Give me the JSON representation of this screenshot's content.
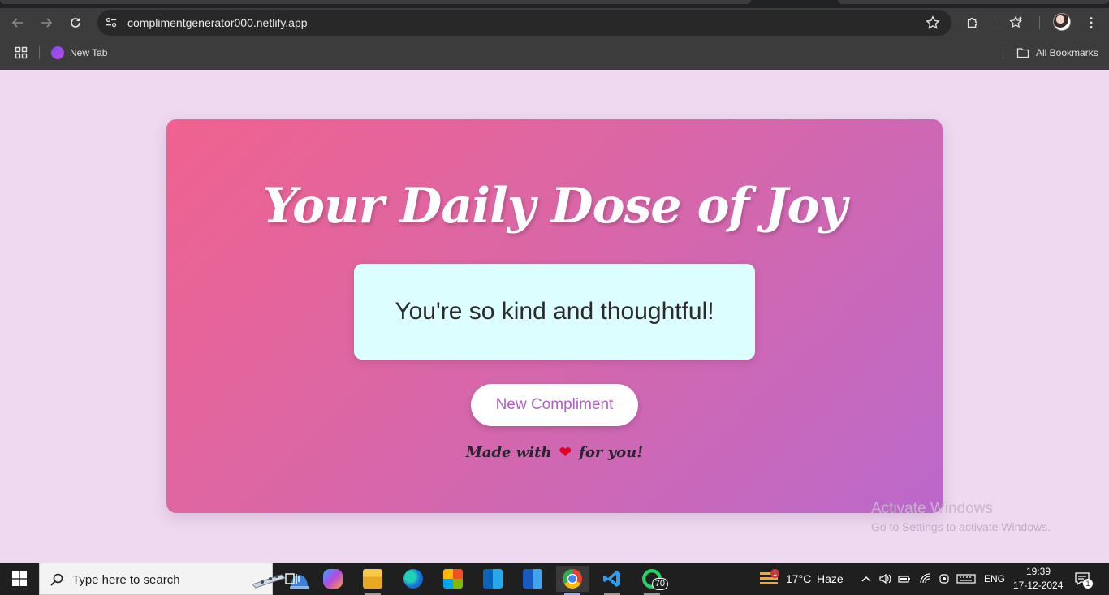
{
  "browser": {
    "url": "complimentgenerator000.netlify.app",
    "bookmarks": [
      {
        "label": "New Tab"
      }
    ],
    "all_bookmarks_label": "All Bookmarks"
  },
  "page": {
    "heading": "Your Daily Dose of Joy",
    "compliment": "You're so kind and thoughtful!",
    "button_label": "New Compliment",
    "footer_before": "Made with",
    "footer_after": "for you!"
  },
  "watermark": {
    "line1": "Activate Windows",
    "line2": "Go to Settings to activate Windows."
  },
  "taskbar": {
    "search_placeholder": "Type here to search",
    "whatsapp_badge": "70",
    "weather_badge": "1",
    "temperature": "17°C",
    "weather": "Haze",
    "language": "ENG",
    "time": "19:39",
    "date": "17-12-2024",
    "notification_count": "1"
  },
  "colors": {
    "page_bg": "#eed9f0",
    "card_gradient_start": "#f0628f",
    "card_gradient_end": "#bb68cb",
    "compliment_bg": "#dcfefe",
    "button_text": "#b25fc4",
    "heart": "#e60023"
  },
  "icons": [
    "back-icon",
    "forward-icon",
    "reload-icon",
    "site-info-icon",
    "star-icon",
    "extensions-icon",
    "bookmarks-icon",
    "menu-icon",
    "apps-grid-icon",
    "folder-icon",
    "heart-icon",
    "windows-start-icon",
    "search-icon"
  ]
}
